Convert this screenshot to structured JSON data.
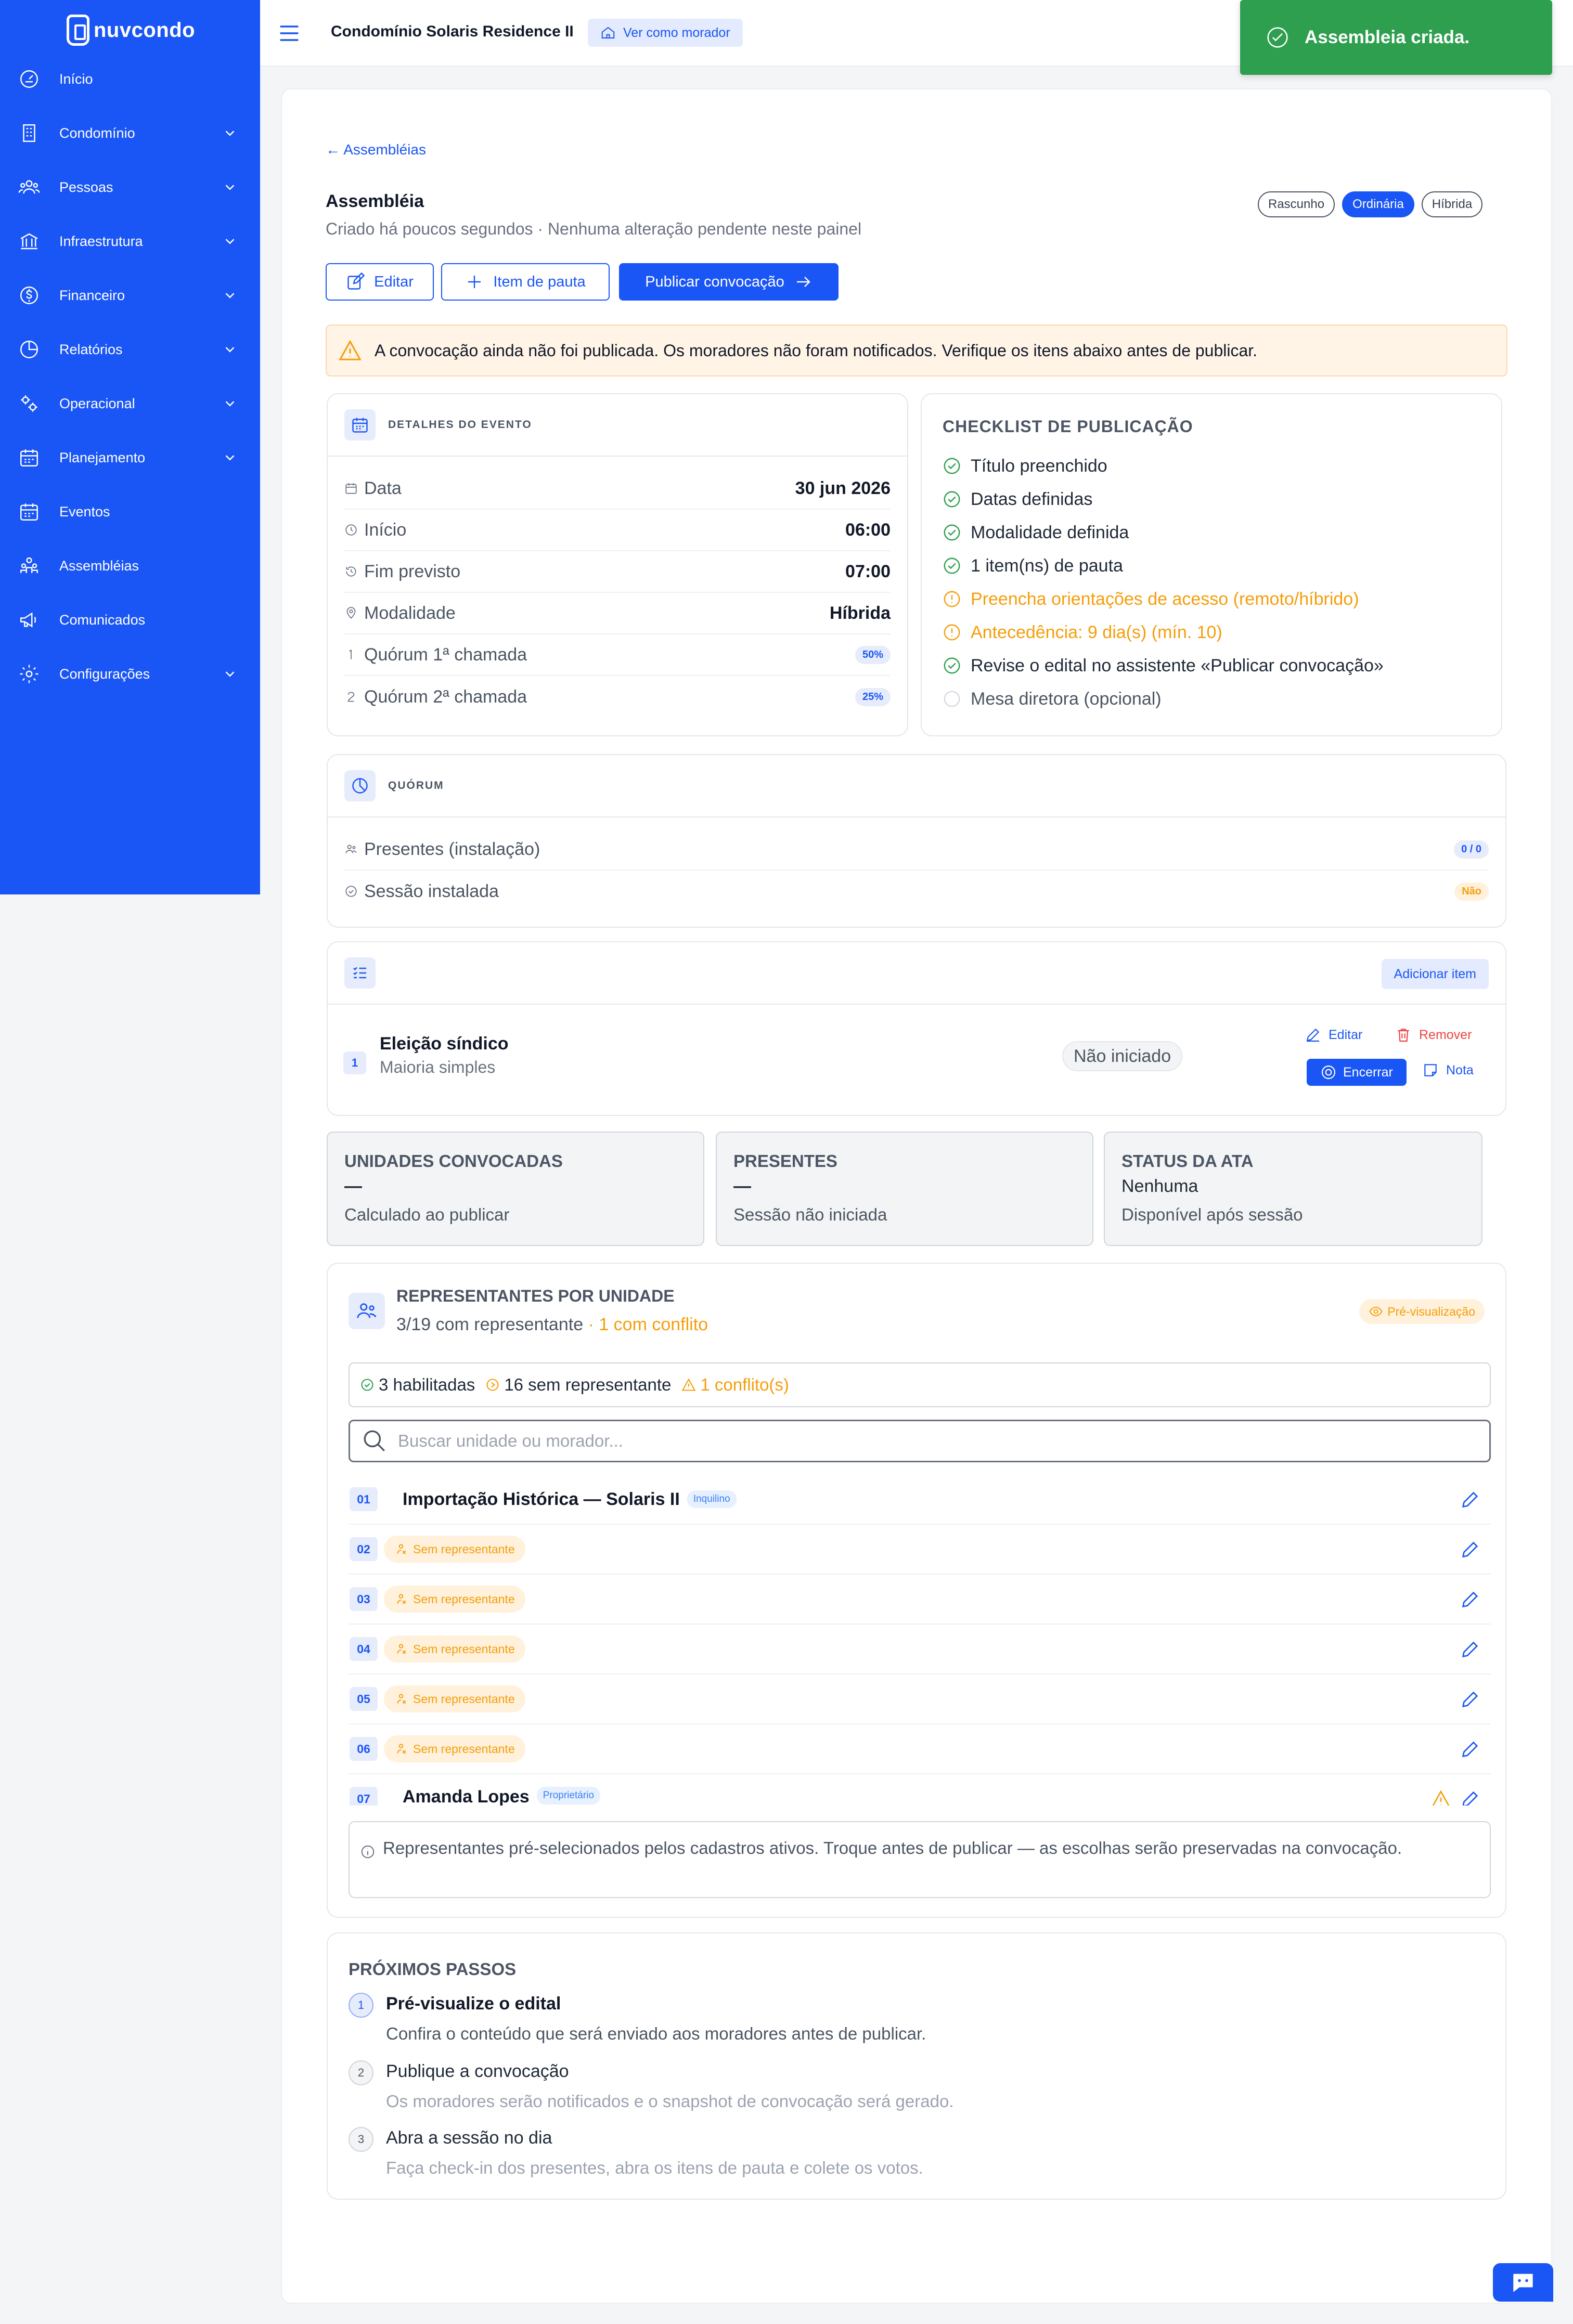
{
  "brand": {
    "name": "nuvcondo"
  },
  "sidebar": {
    "items": [
      {
        "label": "Início",
        "icon": "dashboard-icon",
        "has_children": false
      },
      {
        "label": "Condomínio",
        "icon": "building-icon",
        "has_children": true
      },
      {
        "label": "Pessoas",
        "icon": "people-icon",
        "has_children": true
      },
      {
        "label": "Infraestrutura",
        "icon": "bank-icon",
        "has_children": true
      },
      {
        "label": "Financeiro",
        "icon": "dollar-icon",
        "has_children": true
      },
      {
        "label": "Relatórios",
        "icon": "pie-chart-icon",
        "has_children": true
      },
      {
        "label": "Operacional",
        "icon": "gears-icon",
        "has_children": true
      },
      {
        "label": "Planejamento",
        "icon": "calendar-icon",
        "has_children": true
      },
      {
        "label": "Eventos",
        "icon": "calendar-icon",
        "has_children": false
      },
      {
        "label": "Assembléias",
        "icon": "group-icon",
        "has_children": false
      },
      {
        "label": "Comunicados",
        "icon": "megaphone-icon",
        "has_children": false
      },
      {
        "label": "Configurações",
        "icon": "settings-icon",
        "has_children": true
      }
    ]
  },
  "topbar": {
    "condo_name": "Condomínio Solaris Residence II",
    "view_as_label": "Ver como morador"
  },
  "toast": {
    "message": "Assembleia criada."
  },
  "page": {
    "back_label": "← Assembléias",
    "title": "Assembléia",
    "subtitle": "Criado há poucos segundos · Nenhuma alteração pendente neste painel",
    "badges": [
      {
        "label": "Rascunho",
        "active": false
      },
      {
        "label": "Ordinária",
        "active": true
      },
      {
        "label": "Híbrida",
        "active": false
      }
    ],
    "actions": {
      "edit": "Editar",
      "add_item": "Item de pauta",
      "publish": "Publicar convocação"
    },
    "alert": "A convocação ainda não foi publicada. Os moradores não foram notificados. Verifique os itens abaixo antes de publicar."
  },
  "event_details": {
    "title": "DETALHES DO EVENTO",
    "rows": [
      {
        "label": "Data",
        "value": "30 jun 2026",
        "icon": "calendar-icon"
      },
      {
        "label": "Início",
        "value": "06:00",
        "icon": "clock-icon"
      },
      {
        "label": "Fim previsto",
        "value": "07:00",
        "icon": "history-icon"
      },
      {
        "label": "Modalidade",
        "value": "Híbrida",
        "icon": "location-icon"
      },
      {
        "label": "Quórum 1ª chamada",
        "value": "50%",
        "icon": "number-one-icon"
      },
      {
        "label": "Quórum 2ª chamada",
        "value": "25%",
        "icon": "number-two-icon"
      }
    ]
  },
  "checklist": {
    "title": "CHECKLIST DE PUBLICAÇÃO",
    "items": [
      {
        "label": "Título preenchido",
        "status": "ok"
      },
      {
        "label": "Datas definidas",
        "status": "ok"
      },
      {
        "label": "Modalidade definida",
        "status": "ok"
      },
      {
        "label": "1 item(ns) de pauta",
        "status": "ok"
      },
      {
        "label": "Preencha orientações de acesso (remoto/híbrido)",
        "status": "warn"
      },
      {
        "label": "Antecedência: 9 dia(s) (mín. 10)",
        "status": "warn"
      },
      {
        "label": "Revise o edital no assistente «Publicar convocação»",
        "status": "ok"
      },
      {
        "label": "Mesa diretora (opcional)",
        "status": "optional"
      }
    ]
  },
  "quorum": {
    "title": "QUÓRUM",
    "rows": [
      {
        "label": "Presentes (instalação)",
        "value": "0 / 0",
        "icon": "people-icon"
      },
      {
        "label": "Sessão instalada",
        "value": "Não",
        "icon": "check-circle-icon"
      }
    ]
  },
  "agenda": {
    "add_label": "Adicionar item",
    "items": [
      {
        "number": "1",
        "title": "Eleição síndico",
        "subtitle": "Maioria simples",
        "status": "Não iniciado",
        "actions": {
          "edit": "Editar",
          "remove": "Remover",
          "close": "Encerrar",
          "note": "Nota"
        }
      }
    ]
  },
  "stats": [
    {
      "title": "UNIDADES CONVOCADAS",
      "value": "—",
      "sub": "Calculado ao publicar"
    },
    {
      "title": "PRESENTES",
      "value": "—",
      "sub": "Sessão não iniciada"
    },
    {
      "title": "STATUS DA ATA",
      "value": "Nenhuma",
      "sub": "Disponível após sessão"
    }
  ],
  "representatives": {
    "title": "REPRESENTANTES POR UNIDADE",
    "summary": "3/19 com representante",
    "conflict_text": "· 1 com conflito",
    "preview_label": "Pré-visualização",
    "counts": {
      "enabled": "3 habilitadas",
      "without": "16 sem representante",
      "conflicts": "1 conflito(s)"
    },
    "search_placeholder": "Buscar unidade ou morador...",
    "units": [
      {
        "number": "01",
        "name": "Importação Histórica — Solaris II",
        "role": "Inquilino",
        "no_rep": false,
        "warn": false
      },
      {
        "number": "02",
        "name": "",
        "role": "",
        "no_rep": true,
        "warn": false
      },
      {
        "number": "03",
        "name": "",
        "role": "",
        "no_rep": true,
        "warn": false
      },
      {
        "number": "04",
        "name": "",
        "role": "",
        "no_rep": true,
        "warn": false
      },
      {
        "number": "05",
        "name": "",
        "role": "",
        "no_rep": true,
        "warn": false
      },
      {
        "number": "06",
        "name": "",
        "role": "",
        "no_rep": true,
        "warn": false
      },
      {
        "number": "07",
        "name": "Amanda Lopes",
        "role": "Proprietário",
        "no_rep": false,
        "warn": true
      }
    ],
    "no_rep_label": "Sem representante",
    "info": "Representantes pré-selecionados pelos cadastros ativos. Troque antes de publicar — as escolhas serão preservadas na convocação."
  },
  "next_steps": {
    "title": "PRÓXIMOS PASSOS",
    "steps": [
      {
        "number": "1",
        "title": "Pré-visualize o edital",
        "desc": "Confira o conteúdo que será enviado aos moradores antes de publicar."
      },
      {
        "number": "2",
        "title": "Publique a convocação",
        "desc": "Os moradores serão notificados e o snapshot de convocação será gerado."
      },
      {
        "number": "3",
        "title": "Abra a sessão no dia",
        "desc": "Faça check-in dos presentes, abra os itens de pauta e colete os votos."
      }
    ]
  },
  "colors": {
    "primary": "#1a56f5",
    "success": "#2e9f4f",
    "warning": "#f59e0b",
    "danger": "#ef4444"
  }
}
